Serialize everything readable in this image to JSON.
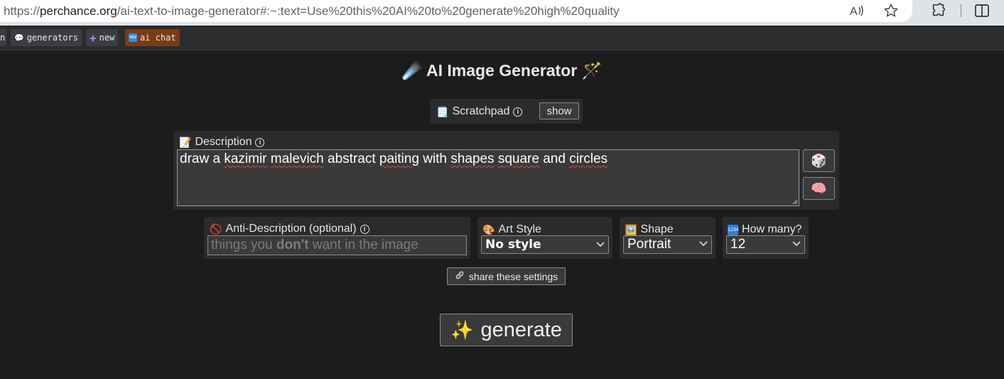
{
  "browser": {
    "url_prefix": "https://",
    "url_host": "perchance.org",
    "url_rest": "/ai-text-to-image-generator#:~:text=Use%20this%20AI%20to%20generate%20high%20quality",
    "icons": [
      "read-aloud-icon",
      "favorite-star-icon",
      "extensions-icon",
      "split-screen-icon"
    ]
  },
  "nav": {
    "partial_label": "n",
    "generators_label": "generators",
    "new_label": "new",
    "ai_chat_label": "ai chat"
  },
  "page": {
    "title": "AI Image Generator",
    "scratchpad_label": "Scratchpad",
    "scratchpad_button": "show",
    "description_label": "Description",
    "description_value": "draw a kazimir malevich abstract paiting with shapes square and circles",
    "anti_label": "Anti-Description (optional)",
    "anti_placeholder_pre": "things you ",
    "anti_placeholder_bold": "don't",
    "anti_placeholder_post": " want in the image",
    "art_style_label": "Art Style",
    "art_style_value": "No style",
    "shape_label": "Shape",
    "shape_value": "Portrait",
    "how_many_label": "How many?",
    "how_many_value": "12",
    "share_label": "share these settings",
    "generate_label": "generate"
  },
  "colors": {
    "page_bg": "#1c1c1c",
    "panel_bg": "#2b2b2b",
    "ai_chat_bg": "#7a3c14"
  }
}
